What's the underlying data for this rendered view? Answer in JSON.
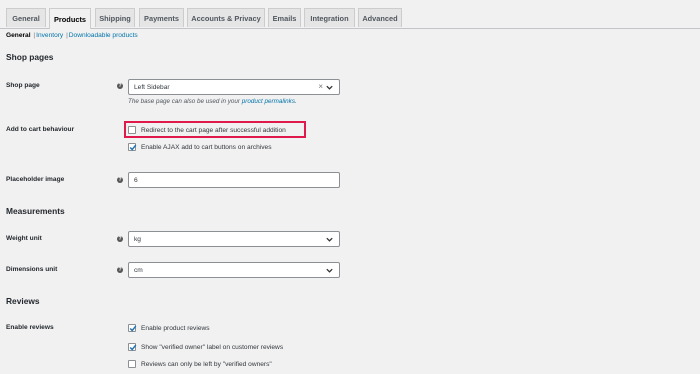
{
  "tabs": [
    "General",
    "Products",
    "Shipping",
    "Payments",
    "Accounts & Privacy",
    "Emails",
    "Integration",
    "Advanced"
  ],
  "subnav": {
    "current": "General",
    "links": [
      "Inventory",
      "Downloadable products"
    ]
  },
  "sections": {
    "shop_pages": "Shop pages",
    "measurements": "Measurements",
    "reviews": "Reviews"
  },
  "shop_page": {
    "label": "Shop page",
    "value": "Left Sidebar",
    "desc_text": "The base page can also be used in your",
    "desc_link": "product permalinks",
    "desc_end": "."
  },
  "add_to_cart": {
    "label": "Add to cart behaviour",
    "redirect": "Redirect to the cart page after successful addition",
    "ajax": "Enable AJAX add to cart buttons on archives"
  },
  "placeholder_image": {
    "label": "Placeholder image",
    "value": "6"
  },
  "weight_unit": {
    "label": "Weight unit",
    "value": "kg"
  },
  "dimensions_unit": {
    "label": "Dimensions unit",
    "value": "cm"
  },
  "enable_reviews": {
    "label": "Enable reviews",
    "product_reviews": "Enable product reviews",
    "verified_label": "Show \"verified owner\" label on customer reviews",
    "verified_only": "Reviews can only be left by \"verified owners\""
  },
  "checked": {
    "redirect": false,
    "ajax": true,
    "product_reviews": true,
    "verified_label": true,
    "verified_only": false
  },
  "colors": {
    "link": "#0073aa",
    "highlight": "#e0194d",
    "check": "#2271b1"
  }
}
